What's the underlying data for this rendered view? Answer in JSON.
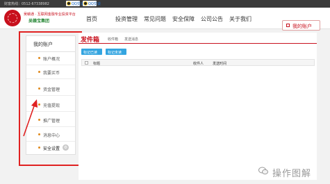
{
  "topbar": {
    "hotline": "财富热线：0512-67338982",
    "qq_buttons": [
      "QQ交谈",
      "QQ交谈"
    ]
  },
  "header": {
    "logo_text": "吴赣通 · 互联网金融专业投资平台",
    "logo_sub": "吴赣宝集团",
    "nav": [
      "首页",
      "投资管理",
      "常见问题",
      "安全保障",
      "公司公告",
      "关于我们"
    ],
    "account_button": "我的账户"
  },
  "sidebar": {
    "title": "我的账户",
    "items": [
      {
        "label": "账户概况"
      },
      {
        "label": "我要买币"
      },
      {
        "label": "资金管理"
      },
      {
        "label": "充值提现"
      },
      {
        "label": "推广管理"
      },
      {
        "label": "消息中心"
      },
      {
        "label": "安全设置"
      }
    ]
  },
  "main": {
    "title": "发件箱",
    "tabs": [
      "收件箱",
      "发送消息"
    ],
    "buttons": [
      "标记已读",
      "标记未读"
    ],
    "table_headers": [
      "标题",
      "收件人",
      "发送时间"
    ]
  },
  "watermark": "操作图解",
  "colors": {
    "brand_red": "#c8101d",
    "highlight_red": "#e02121",
    "button_blue": "#34a5e0"
  }
}
